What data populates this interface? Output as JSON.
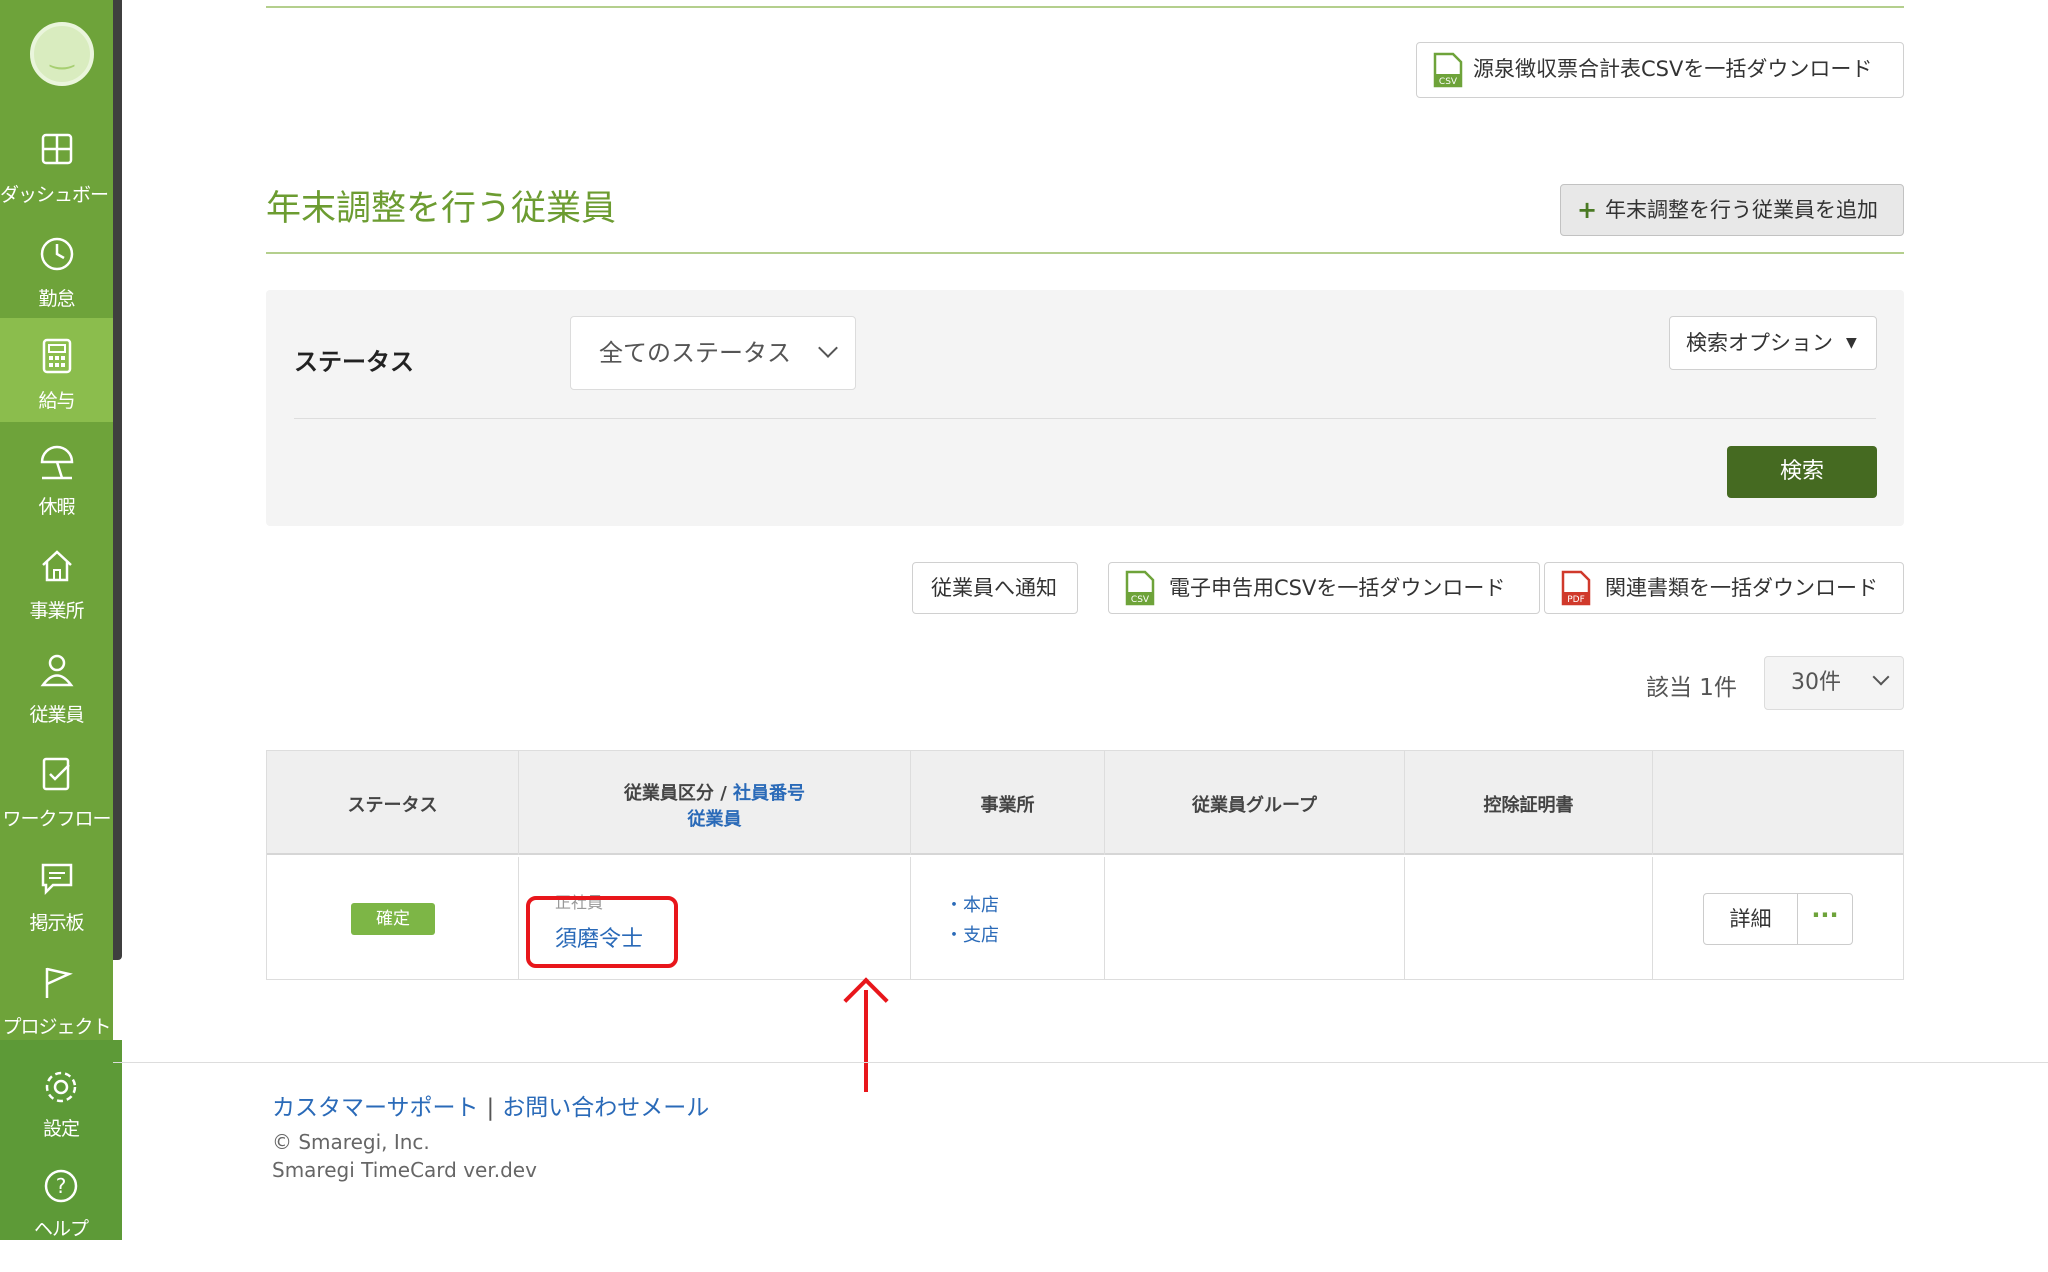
{
  "sidebar": {
    "items": [
      {
        "label": "ダッシュボード",
        "icon": "dashboard-icon"
      },
      {
        "label": "勤怠",
        "icon": "clock-icon"
      },
      {
        "label": "給与",
        "icon": "calculator-icon"
      },
      {
        "label": "休暇",
        "icon": "beach-umbrella-icon"
      },
      {
        "label": "事業所",
        "icon": "home-icon"
      },
      {
        "label": "従業員",
        "icon": "person-icon"
      },
      {
        "label": "ワークフロー",
        "icon": "checklist-icon"
      },
      {
        "label": "掲示板",
        "icon": "message-icon"
      },
      {
        "label": "プロジェクト",
        "icon": "flag-icon"
      },
      {
        "label": "設定",
        "icon": "gear-icon"
      },
      {
        "label": "ヘルプ",
        "icon": "help-icon"
      }
    ],
    "active_item": "給与"
  },
  "top": {
    "withholding_csv_button": "源泉徴収票合計表CSVを一括ダウンロード"
  },
  "section": {
    "title": "年末調整を行う従業員",
    "add_button": "年末調整を行う従業員を追加"
  },
  "search": {
    "status_label": "ステータス",
    "status_select": "全てのステータス",
    "options_button": "検索オプション",
    "search_button": "検索"
  },
  "actions": {
    "notify_button": "従業員へ通知",
    "etax_csv_button": "電子申告用CSVを一括ダウンロード",
    "docs_button": "関連書類を一括ダウンロード"
  },
  "pagination": {
    "count_label": "該当 1件",
    "per_page": "30件"
  },
  "table": {
    "headers": {
      "status": "ステータス",
      "employee_type": "従業員区分",
      "slash": " / ",
      "employee_number": "社員番号",
      "employee": "従業員",
      "office": "事業所",
      "group": "従業員グループ",
      "deduction": "控除証明書"
    },
    "rows": [
      {
        "status": "確定",
        "employee_type": "正社員",
        "employee_name": "須磨令士",
        "offices": [
          "・本店",
          "・支店"
        ],
        "group": "",
        "deduction": "",
        "detail_button": "詳細",
        "more_button": "···"
      }
    ]
  },
  "footer": {
    "support_link": "カスタマーサポート",
    "separator": "|",
    "mail_link": "お問い合わせメール",
    "copyright": "© Smaregi, Inc.",
    "version": "Smaregi TimeCard ver.dev"
  },
  "colors": {
    "sidebar": "#6ea33a",
    "sidebar_active": "#8bbd4d",
    "title_green": "#6c9c31",
    "search_button": "#456a21",
    "badge": "#7db646",
    "link": "#2a6ab8",
    "highlight": "#e8161b"
  }
}
